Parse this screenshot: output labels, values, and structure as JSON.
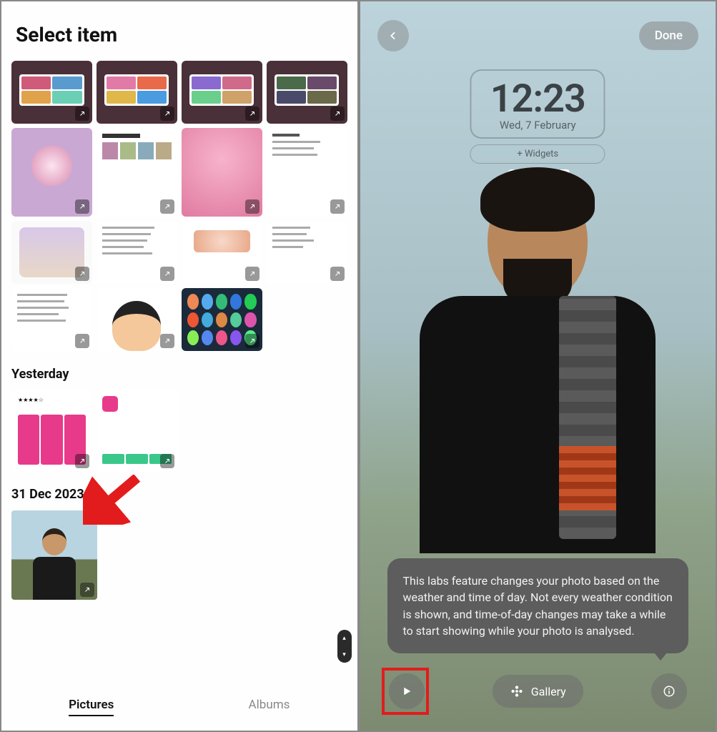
{
  "left": {
    "title": "Select item",
    "sections": {
      "yesterday": "Yesterday",
      "dec31": "31 Dec 2023"
    },
    "tabs": {
      "pictures": "Pictures",
      "albums": "Albums"
    }
  },
  "right": {
    "done_label": "Done",
    "clock": {
      "time": "12:23",
      "date": "Wed, 7 February"
    },
    "widgets_label": "+  Widgets",
    "tooltip": "This labs feature changes your photo based on the weather and time of day. Not every weather condition is shown, and time-of-day changes may take a while to start showing while your photo is analysed.",
    "gallery_label": "Gallery"
  },
  "annotations": {
    "arrow_target": "photo-thumbnail-31-dec",
    "red_box_target": "play-button"
  }
}
